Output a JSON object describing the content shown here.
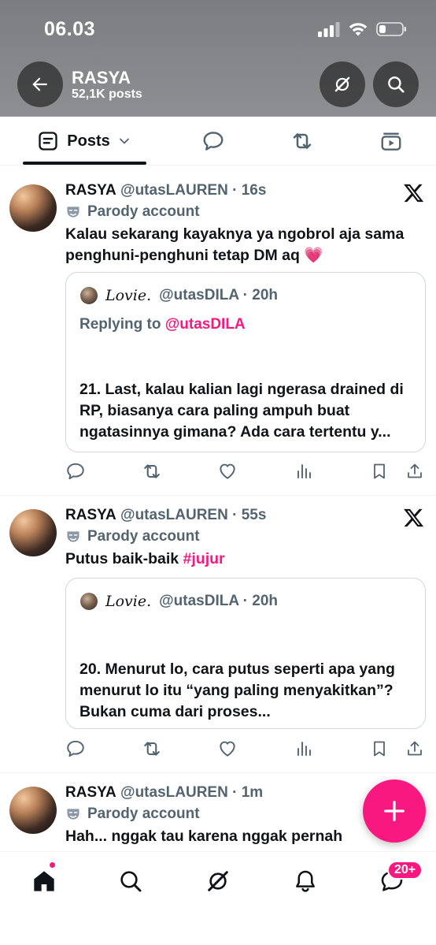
{
  "status_bar": {
    "time": "06.03"
  },
  "header": {
    "name": "RASYA",
    "post_count": "52,1K posts",
    "back_icon": "arrow-left-icon",
    "grok_icon": "grok-icon",
    "search_icon": "search-icon"
  },
  "tabs": [
    {
      "label": "Posts",
      "icon": "posts-list-icon",
      "selected": true
    },
    {
      "label": "",
      "icon": "replies-bubble-icon"
    },
    {
      "label": "",
      "icon": "repost-icon"
    },
    {
      "label": "",
      "icon": "media-icon"
    }
  ],
  "posts": [
    {
      "name": "RASYA",
      "handle": "@utasLAUREN",
      "time": "· 16s",
      "parody_label": "Parody account",
      "text": "Kalau sekarang kayaknya ya ngobrol aja sama penghuni-penghuni tetap DM aq 💗",
      "quote": {
        "name": "𝐿𝑜𝑣𝑖𝑒.",
        "handle_time": "@utasDILA · 20h",
        "replying_prefix": "Replying to ",
        "replying_to": "@utasDILA",
        "text": "21. Last, kalau kalian lagi ngerasa drained di RP, biasanya cara paling ampuh buat ngatasinnya gimana? Ada cara tertentu y..."
      }
    },
    {
      "name": "RASYA",
      "handle": "@utasLAUREN",
      "time": "· 55s",
      "parody_label": "Parody account",
      "text_prefix": "Putus baik-baik ",
      "hashtag": "#jujur",
      "quote": {
        "name": "𝐿𝑜𝑣𝑖𝑒.",
        "handle_time": "@utasDILA · 20h",
        "text": "20. Menurut lo, cara putus seperti apa yang menurut lo itu “yang paling menyakitkan”? Bukan cuma dari proses..."
      }
    },
    {
      "name": "RASYA",
      "handle": "@utasLAUREN",
      "time": "· 1m",
      "parody_label": "Parody account",
      "text": "Hah... nggak tau karena nggak pernah"
    }
  ],
  "fab": {
    "icon": "plus-icon"
  },
  "bottom_nav": {
    "items": [
      "home-icon",
      "search-icon",
      "grok-icon",
      "notifications-bell-icon",
      "messages-icon"
    ],
    "messages_badge": "20+"
  },
  "colors": {
    "accent": "#f91880",
    "secondary_text": "#536471",
    "border": "#cfd9de"
  }
}
